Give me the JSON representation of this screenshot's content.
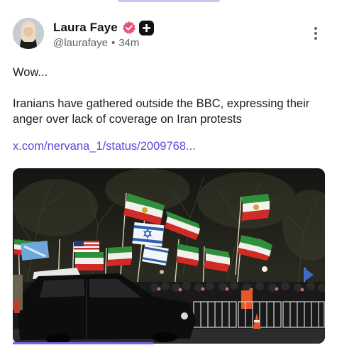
{
  "post": {
    "author": {
      "display_name": "Laura Faye",
      "handle": "@laurafaye",
      "time_ago": "34m",
      "separator": "•",
      "verified_color": "#e8537a"
    },
    "text_line_1": "Wow...",
    "text_line_2": "Iranians have gathered outside the BBC, expressing their anger over lack of coverage on Iran protests",
    "link_text": "x.com/nervana_1/status/2009768...",
    "media": {
      "description_icon": "video-thumbnail",
      "progress_fraction": 0.45
    }
  },
  "colors": {
    "link": "#5b49d6",
    "accent": "#7b63e6",
    "verified_badge": "#e8537a"
  }
}
